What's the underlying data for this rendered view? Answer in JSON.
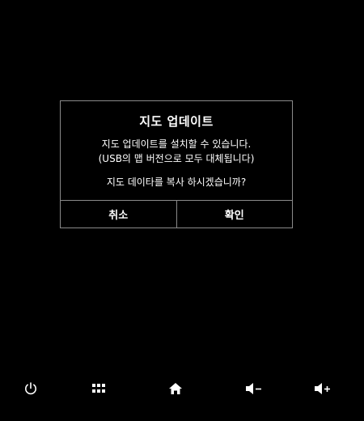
{
  "dialog": {
    "title": "지도 업데이트",
    "message_line1": "지도 업데이트를 설치할 수 있습니다.",
    "message_line2": "(USB의 맵 버전으로 모두 대체됩니다)",
    "question": "지도 데이타를 복사 하시겠습니까?",
    "cancel_label": "취소",
    "confirm_label": "확인"
  },
  "bottom_bar": {
    "icons": [
      "power-icon",
      "apps-grid-icon",
      "home-icon",
      "volume-down-icon",
      "volume-up-icon"
    ]
  },
  "colors": {
    "background": "#000000",
    "text": "#ffffff",
    "border": "#8a8a8a"
  }
}
